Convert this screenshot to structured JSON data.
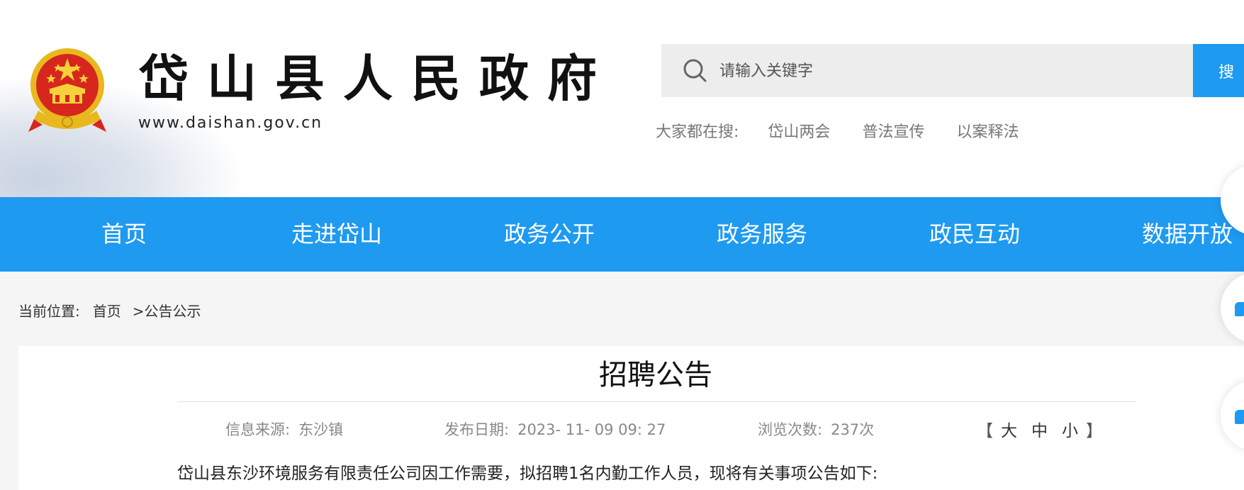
{
  "header": {
    "site_title": "岱山县人民政府",
    "site_url": "www.daishan.gov.cn",
    "emblem_icon": "national-emblem-icon"
  },
  "search": {
    "placeholder": "请输入关键字",
    "button_label": "搜",
    "hot_label": "大家都在搜:",
    "hot_links": [
      "岱山两会",
      "普法宣传",
      "以案释法"
    ]
  },
  "nav": {
    "items": [
      "首页",
      "走进岱山",
      "政务公开",
      "政务服务",
      "政民互动",
      "数据开放"
    ]
  },
  "breadcrumb": {
    "label": "当前位置:",
    "home": "首页",
    "current": ">公告公示"
  },
  "article": {
    "title": "招聘公告",
    "source_label": "信息来源:",
    "source": "东沙镇",
    "date_label": "发布日期:",
    "date": "2023- 11- 09 09: 27",
    "views_label": "浏览次数:",
    "views": "237次",
    "font_open": "【",
    "font_large": "大",
    "font_medium": "中",
    "font_small": "小",
    "font_close": "】",
    "body_first_line": "岱山县东沙环境服务有限责任公司因工作需要，拟招聘1名内勤工作人员，现将有关事项公告如下:"
  },
  "colors": {
    "primary": "#1e9af0",
    "search_bg": "#ededed",
    "page_bg": "#f5f5f5"
  }
}
